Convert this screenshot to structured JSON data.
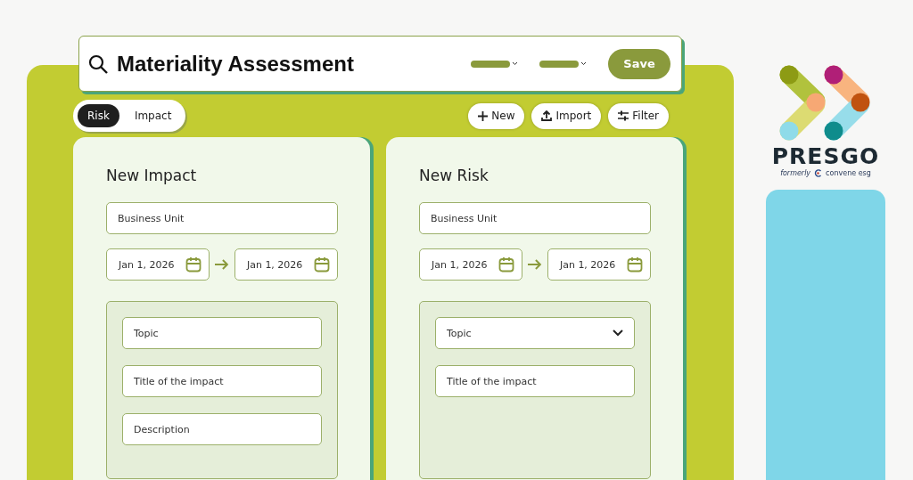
{
  "search": {
    "title": "Materiality Assessment",
    "save_label": "Save"
  },
  "view_toggle": [
    {
      "label": "Risk",
      "selected": true
    },
    {
      "label": "Impact",
      "selected": false
    }
  ],
  "actions": [
    {
      "label": "New",
      "kind": "plus"
    },
    {
      "label": "Import",
      "kind": "upload"
    },
    {
      "label": "Filter",
      "kind": "sliders"
    }
  ],
  "cards": [
    {
      "title": "New Impact",
      "business_unit": {
        "placeholder": "Business Unit"
      },
      "date_range": {
        "start": "Jan 1, 2026",
        "end": "Jan 1, 2026"
      },
      "fields": [
        {
          "kind": "text",
          "placeholder": "Topic"
        },
        {
          "kind": "text",
          "placeholder": "Title of the impact"
        },
        {
          "kind": "text",
          "placeholder": "Description"
        }
      ]
    },
    {
      "title": "New Risk",
      "business_unit": {
        "placeholder": "Business Unit"
      },
      "date_range": {
        "start": "Jan 1, 2026",
        "end": "Jan 1, 2026"
      },
      "fields": [
        {
          "kind": "select",
          "placeholder": "Topic"
        },
        {
          "kind": "text",
          "placeholder": "Title of the impact"
        }
      ]
    }
  ],
  "brand": {
    "name": "PRESGO",
    "formerly": "formerly",
    "former_name": "convene esg"
  }
}
